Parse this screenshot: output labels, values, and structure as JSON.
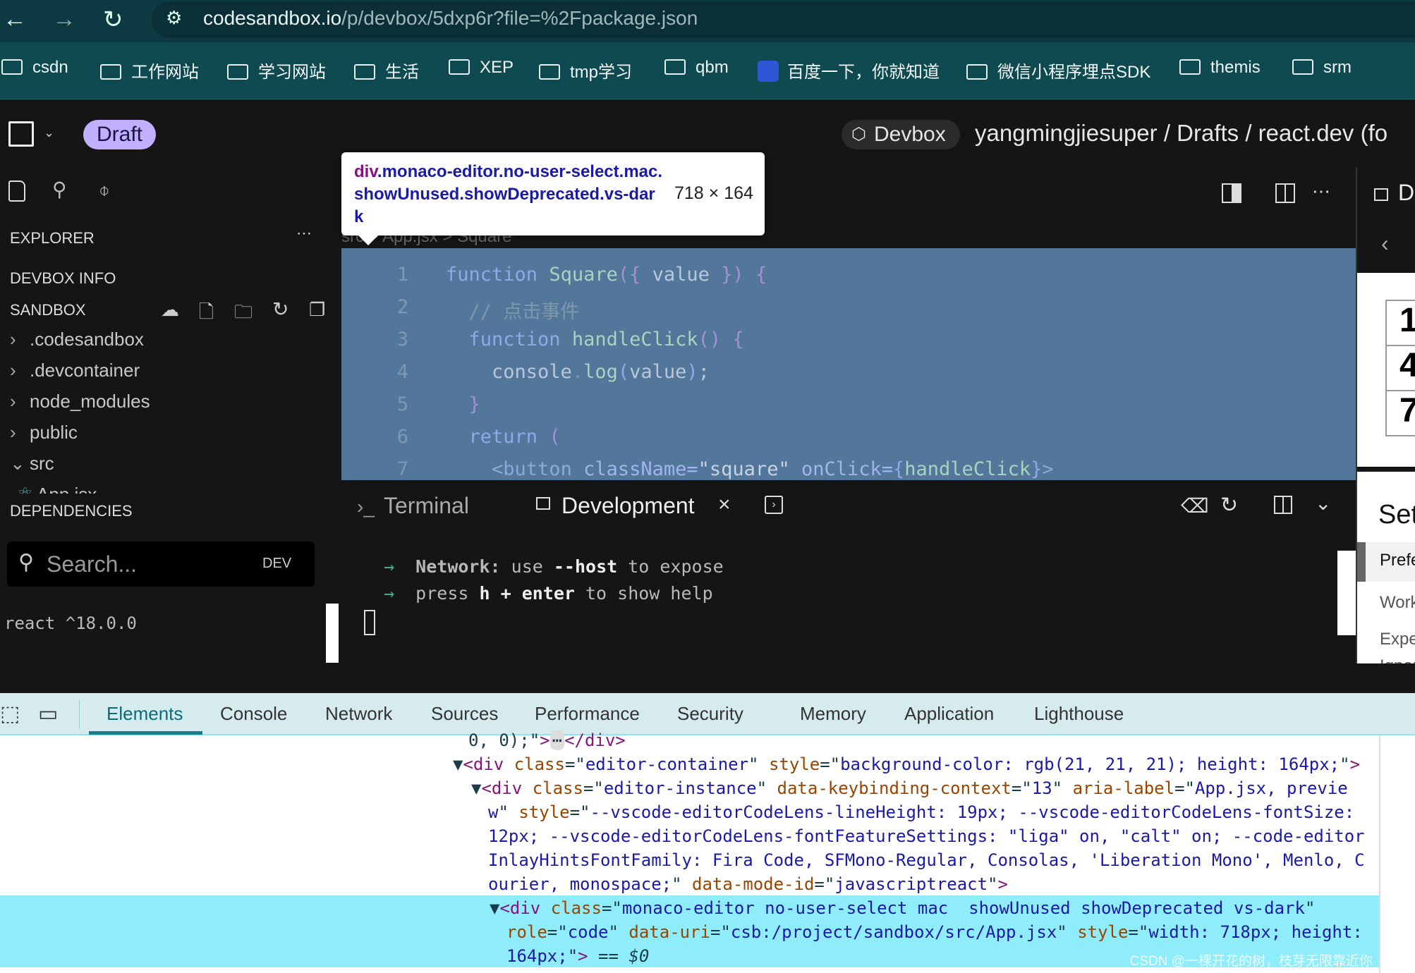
{
  "browser": {
    "url_host": "codesandbox.io",
    "url_path": "/p/devbox/5dxp6r?file=%2Fpackage.json"
  },
  "bookmarks": [
    "csdn",
    "工作网站",
    "学习网站",
    "生活",
    "XEP",
    "tmp学习",
    "qbm",
    "百度一下，你就知道",
    "微信小程序埋点SDK",
    "themis",
    "srm"
  ],
  "header": {
    "draft": "Draft",
    "devbox": "Devbox",
    "breadcrumb": "yangmingjiesuper / Drafts / react.dev (fo"
  },
  "sidebar": {
    "explorer": "EXPLORER",
    "devbox_info": "DEVBOX INFO",
    "sandbox": "SANDBOX",
    "tree": [
      ".codesandbox",
      ".devcontainer",
      "node_modules",
      "public",
      "src",
      "App.jsx"
    ],
    "dependencies": "DEPENDENCIES",
    "search_placeholder": "Search...",
    "search_badge": "DEV",
    "dep": "react ^18.0.0"
  },
  "tooltip": {
    "tag": "div",
    "selector": ".monaco-editor.no-user-select.mac.showUnused.showDeprecated.vs-dark",
    "dims": "718 × 164"
  },
  "editor": {
    "breadcrumb": "src > App.jsx > Square",
    "lines": [
      "1",
      "2",
      "3",
      "4",
      "5",
      "6",
      "7"
    ]
  },
  "terminal": {
    "tab_terminal": "Terminal",
    "tab_dev": "Development",
    "line1_label": "Network:",
    "line1_rest": " use ",
    "line1_flag": "--host",
    "line1_end": " to expose",
    "line2_a": "press ",
    "line2_h": "h + enter",
    "line2_end": " to show help"
  },
  "preview": {
    "title": "D",
    "cells": [
      "1",
      "4",
      "7"
    ],
    "settings": "Set",
    "menu": [
      "Prefe",
      "Work",
      "Expe",
      "Ignor"
    ]
  },
  "devtools": {
    "tabs": [
      "Elements",
      "Console",
      "Network",
      "Sources",
      "Performance",
      "Security",
      "Memory",
      "Application",
      "Lighthouse"
    ],
    "active": "Elements"
  },
  "watermark": "CSDN @一棵开花的树，枝芽无限靠近你"
}
